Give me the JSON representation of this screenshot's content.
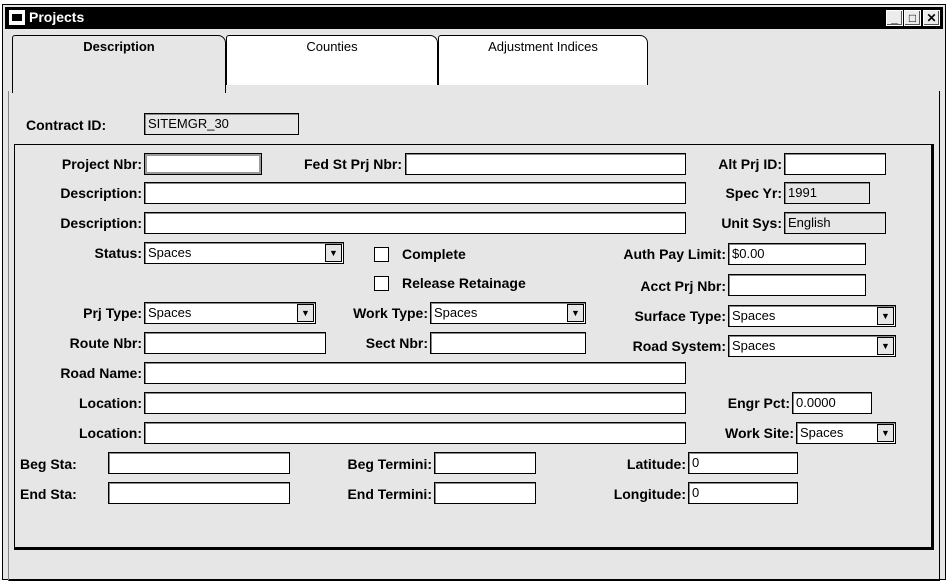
{
  "window": {
    "title": "Projects",
    "buttons": {
      "minimize": "_",
      "maximize": "□",
      "close": "✕"
    }
  },
  "tabs": [
    {
      "label": "Description",
      "active": true
    },
    {
      "label": "Counties",
      "active": false
    },
    {
      "label": "Adjustment Indices",
      "active": false
    }
  ],
  "contract": {
    "label": "Contract ID:",
    "value": "SITEMGR_30"
  },
  "form": {
    "project_nbr": {
      "label": "Project Nbr:",
      "value": ""
    },
    "fed_st_prj_nbr": {
      "label": "Fed St Prj Nbr:",
      "value": ""
    },
    "alt_prj_id": {
      "label": "Alt Prj ID:",
      "value": ""
    },
    "description1": {
      "label": "Description:",
      "value": ""
    },
    "spec_yr": {
      "label": "Spec Yr:",
      "value": "1991"
    },
    "description2": {
      "label": "Description:",
      "value": ""
    },
    "unit_sys": {
      "label": "Unit Sys:",
      "value": "English"
    },
    "status": {
      "label": "Status:",
      "value": "Spaces"
    },
    "complete": {
      "label": "Complete",
      "checked": false
    },
    "release_retainage": {
      "label": "Release Retainage",
      "checked": false
    },
    "auth_pay_limit": {
      "label": "Auth Pay Limit:",
      "value": "$0.00"
    },
    "acct_prj_nbr": {
      "label": "Acct Prj Nbr:",
      "value": ""
    },
    "prj_type": {
      "label": "Prj Type:",
      "value": "Spaces"
    },
    "work_type": {
      "label": "Work Type:",
      "value": "Spaces"
    },
    "surface_type": {
      "label": "Surface Type:",
      "value": "Spaces"
    },
    "route_nbr": {
      "label": "Route Nbr:",
      "value": ""
    },
    "sect_nbr": {
      "label": "Sect Nbr:",
      "value": ""
    },
    "road_system": {
      "label": "Road System:",
      "value": "Spaces"
    },
    "road_name": {
      "label": "Road Name:",
      "value": ""
    },
    "location1": {
      "label": "Location:",
      "value": ""
    },
    "engr_pct": {
      "label": "Engr Pct:",
      "value": "0.0000"
    },
    "location2": {
      "label": "Location:",
      "value": ""
    },
    "work_site": {
      "label": "Work Site:",
      "value": "Spaces"
    },
    "beg_sta": {
      "label": "Beg Sta:",
      "value": ""
    },
    "beg_termini": {
      "label": "Beg Termini:",
      "value": ""
    },
    "latitude": {
      "label": "Latitude:",
      "value": "0"
    },
    "end_sta": {
      "label": "End Sta:",
      "value": ""
    },
    "end_termini": {
      "label": "End Termini:",
      "value": ""
    },
    "longitude": {
      "label": "Longitude:",
      "value": "0"
    }
  },
  "icons": {
    "dropdown": "▼"
  }
}
